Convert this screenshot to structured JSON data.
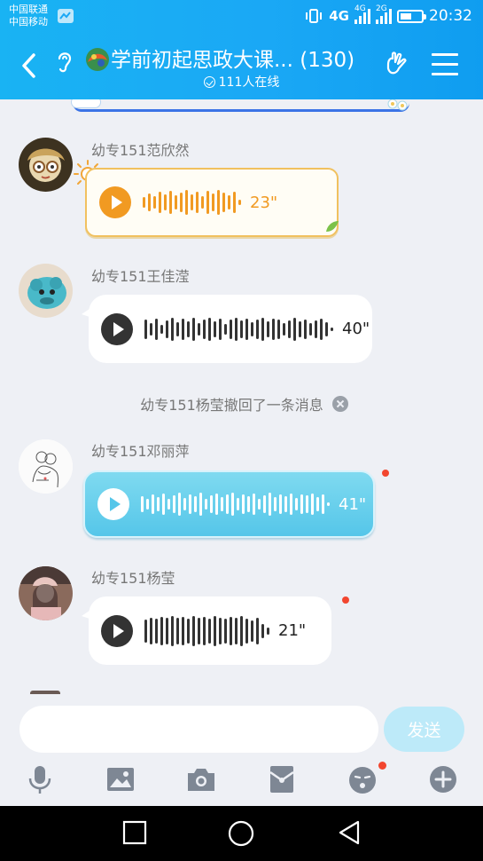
{
  "status_bar": {
    "carrier_1": "中国联通",
    "carrier_2": "中国移动",
    "net_1": "4G",
    "net_2": "4G",
    "net_3": "2G",
    "time": "20:32"
  },
  "header": {
    "title": "学前初起思政大课...",
    "count": "(130)",
    "online": "111人在线",
    "colors": {
      "bar": "#19b3f3"
    },
    "icons": [
      "back-arrow-icon",
      "ear-icon",
      "group-avatar",
      "hand-gesture-icon",
      "menu-icon"
    ]
  },
  "messages": [
    {
      "sender": "幼专151范欣然",
      "duration": "23\"",
      "style": "orange"
    },
    {
      "sender": "幼专151王佳滢",
      "duration": "40\"",
      "style": "dark"
    },
    {
      "sender": "幼专151邓丽萍",
      "duration": "41\"",
      "style": "blue",
      "unread": true
    },
    {
      "sender": "幼专151杨莹",
      "duration": "21\"",
      "style": "dark",
      "unread": true
    }
  ],
  "recall_notice": "幼专151杨莹撤回了一条消息",
  "input": {
    "placeholder": "",
    "send_label": "发送"
  },
  "toolbar_icons": [
    "microphone-icon",
    "image-icon",
    "camera-icon",
    "red-packet-icon",
    "emoji-icon",
    "plus-icon"
  ],
  "accent_colors": {
    "orange": "#f19a22",
    "blue": "#55c6e9",
    "red_dot": "#f2462f",
    "send_disabled": "#bdeaf9"
  }
}
